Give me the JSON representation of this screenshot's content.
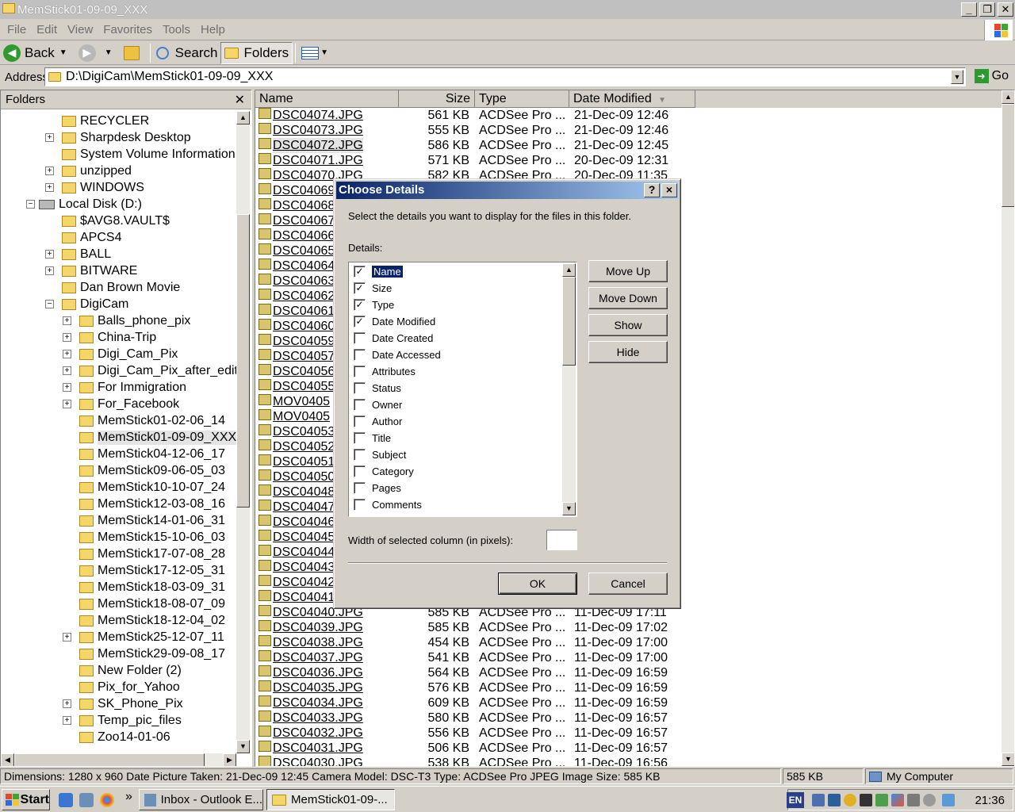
{
  "window": {
    "title": "MemStick01-09-09_XXX"
  },
  "menu": [
    "File",
    "Edit",
    "View",
    "Favorites",
    "Tools",
    "Help"
  ],
  "toolbar": {
    "back": "Back",
    "search": "Search",
    "folders": "Folders"
  },
  "address": {
    "label": "Address",
    "value": "D:\\DigiCam\\MemStick01-09-09_XXX",
    "go": "Go"
  },
  "folders_pane": {
    "title": "Folders",
    "items": [
      {
        "label": "RECYCLER",
        "level": 2,
        "expander": ""
      },
      {
        "label": "Sharpdesk Desktop",
        "level": 2,
        "expander": "+"
      },
      {
        "label": "System Volume Information",
        "level": 2,
        "expander": ""
      },
      {
        "label": "unzipped",
        "level": 2,
        "expander": "+"
      },
      {
        "label": "WINDOWS",
        "level": 2,
        "expander": "+"
      },
      {
        "label": "Local Disk (D:)",
        "level": 1,
        "expander": "-",
        "drive": true
      },
      {
        "label": "$AVG8.VAULT$",
        "level": 2,
        "expander": ""
      },
      {
        "label": "APCS4",
        "level": 2,
        "expander": ""
      },
      {
        "label": "BALL",
        "level": 2,
        "expander": "+"
      },
      {
        "label": "BITWARE",
        "level": 2,
        "expander": "+"
      },
      {
        "label": "Dan Brown Movie",
        "level": 2,
        "expander": ""
      },
      {
        "label": "DigiCam",
        "level": 2,
        "expander": "-"
      },
      {
        "label": "Balls_phone_pix",
        "level": 3,
        "expander": "+"
      },
      {
        "label": "China-Trip",
        "level": 3,
        "expander": "+"
      },
      {
        "label": "Digi_Cam_Pix",
        "level": 3,
        "expander": "+"
      },
      {
        "label": "Digi_Cam_Pix_after_edit",
        "level": 3,
        "expander": "+"
      },
      {
        "label": "For Immigration",
        "level": 3,
        "expander": "+"
      },
      {
        "label": "For_Facebook",
        "level": 3,
        "expander": "+"
      },
      {
        "label": "MemStick01-02-06_14",
        "level": 3,
        "expander": ""
      },
      {
        "label": "MemStick01-09-09_XXX",
        "level": 3,
        "expander": "",
        "selected": true
      },
      {
        "label": "MemStick04-12-06_17",
        "level": 3,
        "expander": ""
      },
      {
        "label": "MemStick09-06-05_03",
        "level": 3,
        "expander": ""
      },
      {
        "label": "MemStick10-10-07_24",
        "level": 3,
        "expander": ""
      },
      {
        "label": "MemStick12-03-08_16",
        "level": 3,
        "expander": ""
      },
      {
        "label": "MemStick14-01-06_31",
        "level": 3,
        "expander": ""
      },
      {
        "label": "MemStick15-10-06_03",
        "level": 3,
        "expander": ""
      },
      {
        "label": "MemStick17-07-08_28",
        "level": 3,
        "expander": ""
      },
      {
        "label": "MemStick17-12-05_31",
        "level": 3,
        "expander": ""
      },
      {
        "label": "MemStick18-03-09_31",
        "level": 3,
        "expander": ""
      },
      {
        "label": "MemStick18-08-07_09",
        "level": 3,
        "expander": ""
      },
      {
        "label": "MemStick18-12-04_02",
        "level": 3,
        "expander": ""
      },
      {
        "label": "MemStick25-12-07_11",
        "level": 3,
        "expander": "+"
      },
      {
        "label": "MemStick29-09-08_17",
        "level": 3,
        "expander": ""
      },
      {
        "label": "New Folder (2)",
        "level": 3,
        "expander": ""
      },
      {
        "label": "Pix_for_Yahoo",
        "level": 3,
        "expander": ""
      },
      {
        "label": "SK_Phone_Pix",
        "level": 3,
        "expander": "+"
      },
      {
        "label": "Temp_pic_files",
        "level": 3,
        "expander": "+"
      },
      {
        "label": "Zoo14-01-06",
        "level": 3,
        "expander": ""
      }
    ]
  },
  "filelist": {
    "columns": [
      "Name",
      "Size",
      "Type",
      "Date Modified"
    ],
    "rows": [
      {
        "name": "DSC04074.JPG",
        "size": "561 KB",
        "type": "ACDSee Pro ...",
        "date": "21-Dec-09 12:46"
      },
      {
        "name": "DSC04073.JPG",
        "size": "555 KB",
        "type": "ACDSee Pro ...",
        "date": "21-Dec-09 12:46"
      },
      {
        "name": "DSC04072.JPG",
        "size": "586 KB",
        "type": "ACDSee Pro ...",
        "date": "21-Dec-09 12:45",
        "selected": true
      },
      {
        "name": "DSC04071.JPG",
        "size": "571 KB",
        "type": "ACDSee Pro ...",
        "date": "20-Dec-09 12:31"
      },
      {
        "name": "DSC04070.JPG",
        "size": "582 KB",
        "type": "ACDSee Pro ...",
        "date": "20-Dec-09 11:35"
      },
      {
        "name": "DSC04069",
        "size": "",
        "type": "",
        "date": ""
      },
      {
        "name": "DSC04068",
        "size": "",
        "type": "",
        "date": ""
      },
      {
        "name": "DSC04067",
        "size": "",
        "type": "",
        "date": ""
      },
      {
        "name": "DSC04066",
        "size": "",
        "type": "",
        "date": ""
      },
      {
        "name": "DSC04065",
        "size": "",
        "type": "",
        "date": ""
      },
      {
        "name": "DSC04064",
        "size": "",
        "type": "",
        "date": ""
      },
      {
        "name": "DSC04063",
        "size": "",
        "type": "",
        "date": ""
      },
      {
        "name": "DSC04062",
        "size": "",
        "type": "",
        "date": ""
      },
      {
        "name": "DSC04061",
        "size": "",
        "type": "",
        "date": ""
      },
      {
        "name": "DSC04060",
        "size": "",
        "type": "",
        "date": ""
      },
      {
        "name": "DSC04059",
        "size": "",
        "type": "",
        "date": ""
      },
      {
        "name": "DSC04057",
        "size": "",
        "type": "",
        "date": ""
      },
      {
        "name": "DSC04056",
        "size": "",
        "type": "",
        "date": ""
      },
      {
        "name": "DSC04055",
        "size": "",
        "type": "",
        "date": ""
      },
      {
        "name": "MOV0405",
        "size": "",
        "type": "",
        "date": ""
      },
      {
        "name": "MOV0405",
        "size": "",
        "type": "",
        "date": ""
      },
      {
        "name": "DSC04053",
        "size": "",
        "type": "",
        "date": ""
      },
      {
        "name": "DSC04052",
        "size": "",
        "type": "",
        "date": ""
      },
      {
        "name": "DSC04051",
        "size": "",
        "type": "",
        "date": ""
      },
      {
        "name": "DSC04050",
        "size": "",
        "type": "",
        "date": ""
      },
      {
        "name": "DSC04048",
        "size": "",
        "type": "",
        "date": ""
      },
      {
        "name": "DSC04047",
        "size": "",
        "type": "",
        "date": ""
      },
      {
        "name": "DSC04046",
        "size": "",
        "type": "",
        "date": ""
      },
      {
        "name": "DSC04045",
        "size": "",
        "type": "",
        "date": ""
      },
      {
        "name": "DSC04044",
        "size": "",
        "type": "",
        "date": ""
      },
      {
        "name": "DSC04043",
        "size": "",
        "type": "",
        "date": ""
      },
      {
        "name": "DSC04042",
        "size": "",
        "type": "",
        "date": ""
      },
      {
        "name": "DSC04041",
        "size": "",
        "type": "",
        "date": ""
      },
      {
        "name": "DSC04040.JPG",
        "size": "585 KB",
        "type": "ACDSee Pro ...",
        "date": "11-Dec-09 17:11"
      },
      {
        "name": "DSC04039.JPG",
        "size": "585 KB",
        "type": "ACDSee Pro ...",
        "date": "11-Dec-09 17:02"
      },
      {
        "name": "DSC04038.JPG",
        "size": "454 KB",
        "type": "ACDSee Pro ...",
        "date": "11-Dec-09 17:00"
      },
      {
        "name": "DSC04037.JPG",
        "size": "541 KB",
        "type": "ACDSee Pro ...",
        "date": "11-Dec-09 17:00"
      },
      {
        "name": "DSC04036.JPG",
        "size": "564 KB",
        "type": "ACDSee Pro ...",
        "date": "11-Dec-09 16:59"
      },
      {
        "name": "DSC04035.JPG",
        "size": "576 KB",
        "type": "ACDSee Pro ...",
        "date": "11-Dec-09 16:59"
      },
      {
        "name": "DSC04034.JPG",
        "size": "609 KB",
        "type": "ACDSee Pro ...",
        "date": "11-Dec-09 16:59"
      },
      {
        "name": "DSC04033.JPG",
        "size": "580 KB",
        "type": "ACDSee Pro ...",
        "date": "11-Dec-09 16:57"
      },
      {
        "name": "DSC04032.JPG",
        "size": "556 KB",
        "type": "ACDSee Pro ...",
        "date": "11-Dec-09 16:57"
      },
      {
        "name": "DSC04031.JPG",
        "size": "506 KB",
        "type": "ACDSee Pro ...",
        "date": "11-Dec-09 16:57"
      },
      {
        "name": "DSC04030.JPG",
        "size": "538 KB",
        "type": "ACDSee Pro ...",
        "date": "11-Dec-09 16:56"
      }
    ]
  },
  "statusbar": {
    "info": "Dimensions: 1280 x 960 Date Picture Taken: 21-Dec-09 12:45 Camera Model: DSC-T3 Type: ACDSee Pro JPEG Image Size: 585 KB",
    "size": "585 KB",
    "location": "My Computer"
  },
  "dialog": {
    "title": "Choose Details",
    "help": "?",
    "close": "×",
    "instruction": "Select the details you want to display for the files in this folder.",
    "details_label": "Details:",
    "details": [
      {
        "label": "Name",
        "checked": true,
        "selected": true
      },
      {
        "label": "Size",
        "checked": true
      },
      {
        "label": "Type",
        "checked": true
      },
      {
        "label": "Date Modified",
        "checked": true
      },
      {
        "label": "Date Created",
        "checked": false
      },
      {
        "label": "Date Accessed",
        "checked": false
      },
      {
        "label": "Attributes",
        "checked": false
      },
      {
        "label": "Status",
        "checked": false
      },
      {
        "label": "Owner",
        "checked": false
      },
      {
        "label": "Author",
        "checked": false
      },
      {
        "label": "Title",
        "checked": false
      },
      {
        "label": "Subject",
        "checked": false
      },
      {
        "label": "Category",
        "checked": false
      },
      {
        "label": "Pages",
        "checked": false
      },
      {
        "label": "Comments",
        "checked": false
      }
    ],
    "move_up": "Move Up",
    "move_down": "Move Down",
    "show": "Show",
    "hide": "Hide",
    "width_label": "Width of selected column (in pixels):",
    "width_value": "",
    "ok": "OK",
    "cancel": "Cancel"
  },
  "taskbar": {
    "start": "Start",
    "tasks": [
      "Inbox - Outlook E...",
      "MemStick01-09-..."
    ],
    "lang": "EN",
    "clock": "21:36"
  }
}
